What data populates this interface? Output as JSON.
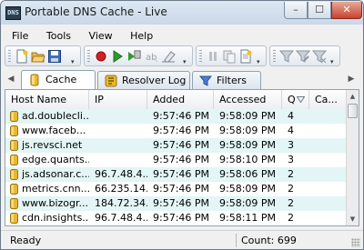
{
  "window": {
    "title": "Portable DNS Cache - Live",
    "app_icon_text": "DNS",
    "minimize_glyph": "–",
    "maximize_glyph": "☐",
    "close_glyph": "✕"
  },
  "menu": [
    "File",
    "Tools",
    "View",
    "Help"
  ],
  "toolbar": {
    "icons": [
      "new-icon",
      "open-icon",
      "save-icon",
      "record-icon",
      "play-icon",
      "step-icon",
      "clear-icon",
      "eraser-icon",
      "pause-icon",
      "copy-icon",
      "document-icon",
      "filter-icon",
      "filter-edit-icon",
      "filter-clear-icon"
    ]
  },
  "tabs": [
    {
      "label": "Cache",
      "icon": "cache-icon",
      "active": true
    },
    {
      "label": "Resolver Log",
      "icon": "resolver-log-icon",
      "active": false
    },
    {
      "label": "Filters",
      "icon": "filter-icon",
      "active": false
    }
  ],
  "columns": [
    "Host Name",
    "IP",
    "Added",
    "Accessed",
    "Q",
    "Ca..."
  ],
  "rows": [
    {
      "host": "ad.doublecli...",
      "ip": "",
      "added": "9:57:46 PM",
      "accessed": "9:58:09 PM",
      "q": "4"
    },
    {
      "host": "www.faceb...",
      "ip": "",
      "added": "9:57:46 PM",
      "accessed": "9:58:09 PM",
      "q": "4"
    },
    {
      "host": "js.revsci.net",
      "ip": "",
      "added": "9:57:46 PM",
      "accessed": "9:58:09 PM",
      "q": "3"
    },
    {
      "host": "edge.quants...",
      "ip": "",
      "added": "9:57:46 PM",
      "accessed": "9:58:10 PM",
      "q": "3"
    },
    {
      "host": "js.adsonar.c...",
      "ip": "96.7.48.4...",
      "added": "9:57:46 PM",
      "accessed": "9:58:06 PM",
      "q": "2"
    },
    {
      "host": "metrics.cnn....",
      "ip": "66.235.14...",
      "added": "9:57:46 PM",
      "accessed": "9:58:09 PM",
      "q": "2"
    },
    {
      "host": "www.bizogr...",
      "ip": "184.72.34...",
      "added": "9:57:46 PM",
      "accessed": "9:58:09 PM",
      "q": "2"
    },
    {
      "host": "cdn.insights....",
      "ip": "96.7.48.4...",
      "added": "9:57:46 PM",
      "accessed": "9:58:11 PM",
      "q": "2"
    }
  ],
  "status": {
    "left": "Ready",
    "count": "Count: 699"
  },
  "colors": {
    "row_alt": "#e3f5f5",
    "selection_border": "#8fa2b5",
    "record": "#d42020",
    "play": "#2e9a2e"
  }
}
